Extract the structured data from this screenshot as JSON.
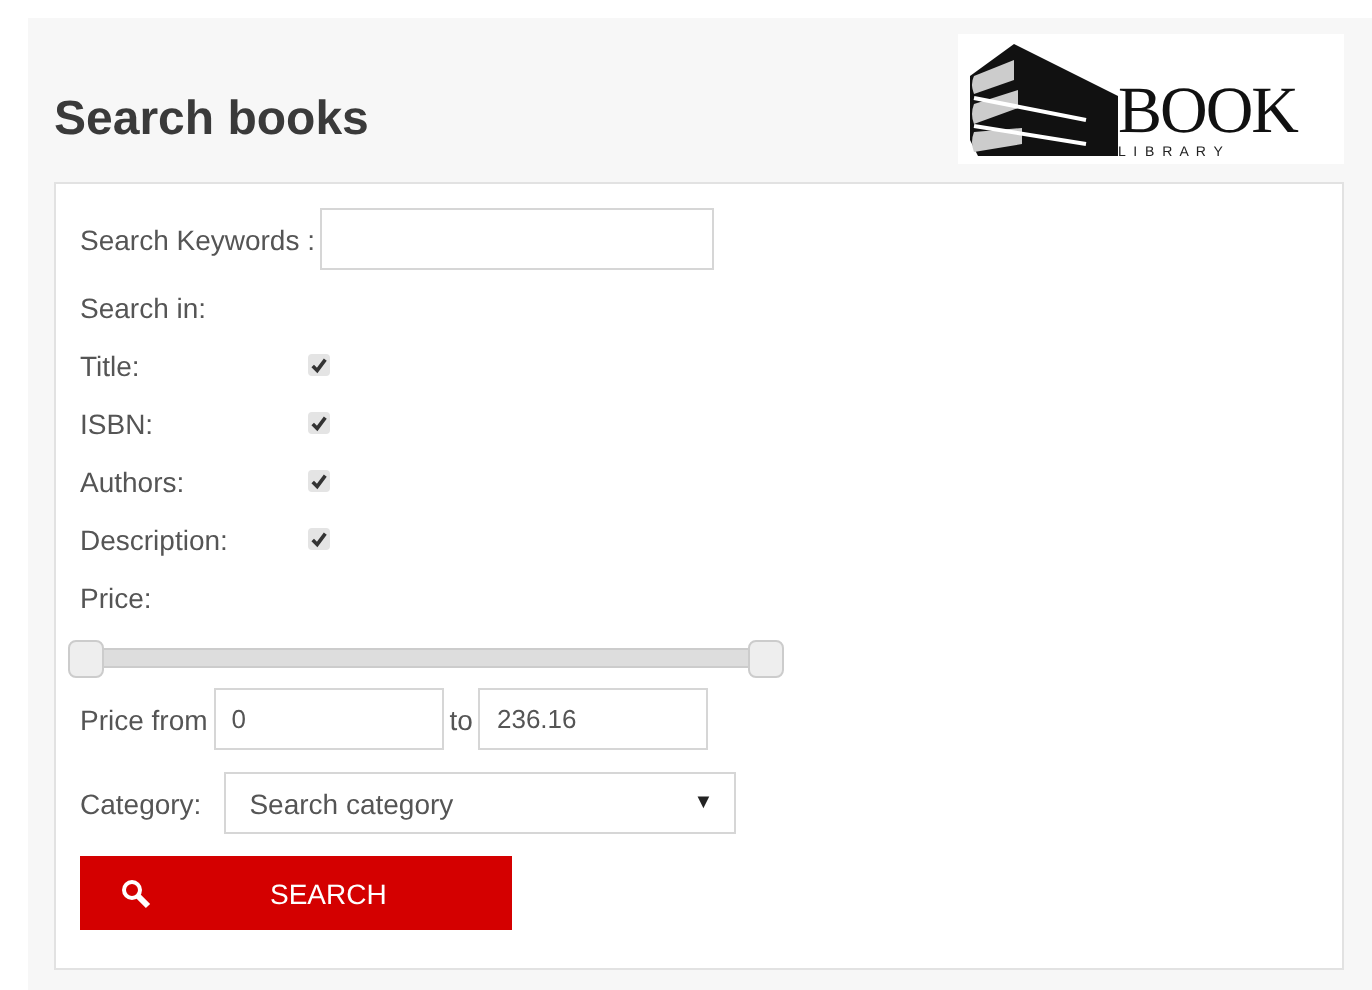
{
  "header": {
    "title": "Search books",
    "logo": {
      "word": "BOOK",
      "subword": "L I B R A R Y"
    }
  },
  "form": {
    "keywords": {
      "label": "Search Keywords :"
    },
    "search_in": {
      "label": "Search in:",
      "options": [
        {
          "label": "Title:",
          "checked": true
        },
        {
          "label": "ISBN:",
          "checked": true
        },
        {
          "label": "Authors:",
          "checked": true
        },
        {
          "label": "Description:",
          "checked": true
        }
      ]
    },
    "price": {
      "label": "Price:",
      "thumbs": [
        {
          "level": 0
        },
        {
          "level": 1
        }
      ],
      "from_label": "Price from",
      "from_value": "0",
      "to_label": "to",
      "to_value": "236.16"
    },
    "category": {
      "label": "Category:",
      "value": "Search category",
      "caret": "▼"
    },
    "button": "SEARCH"
  }
}
